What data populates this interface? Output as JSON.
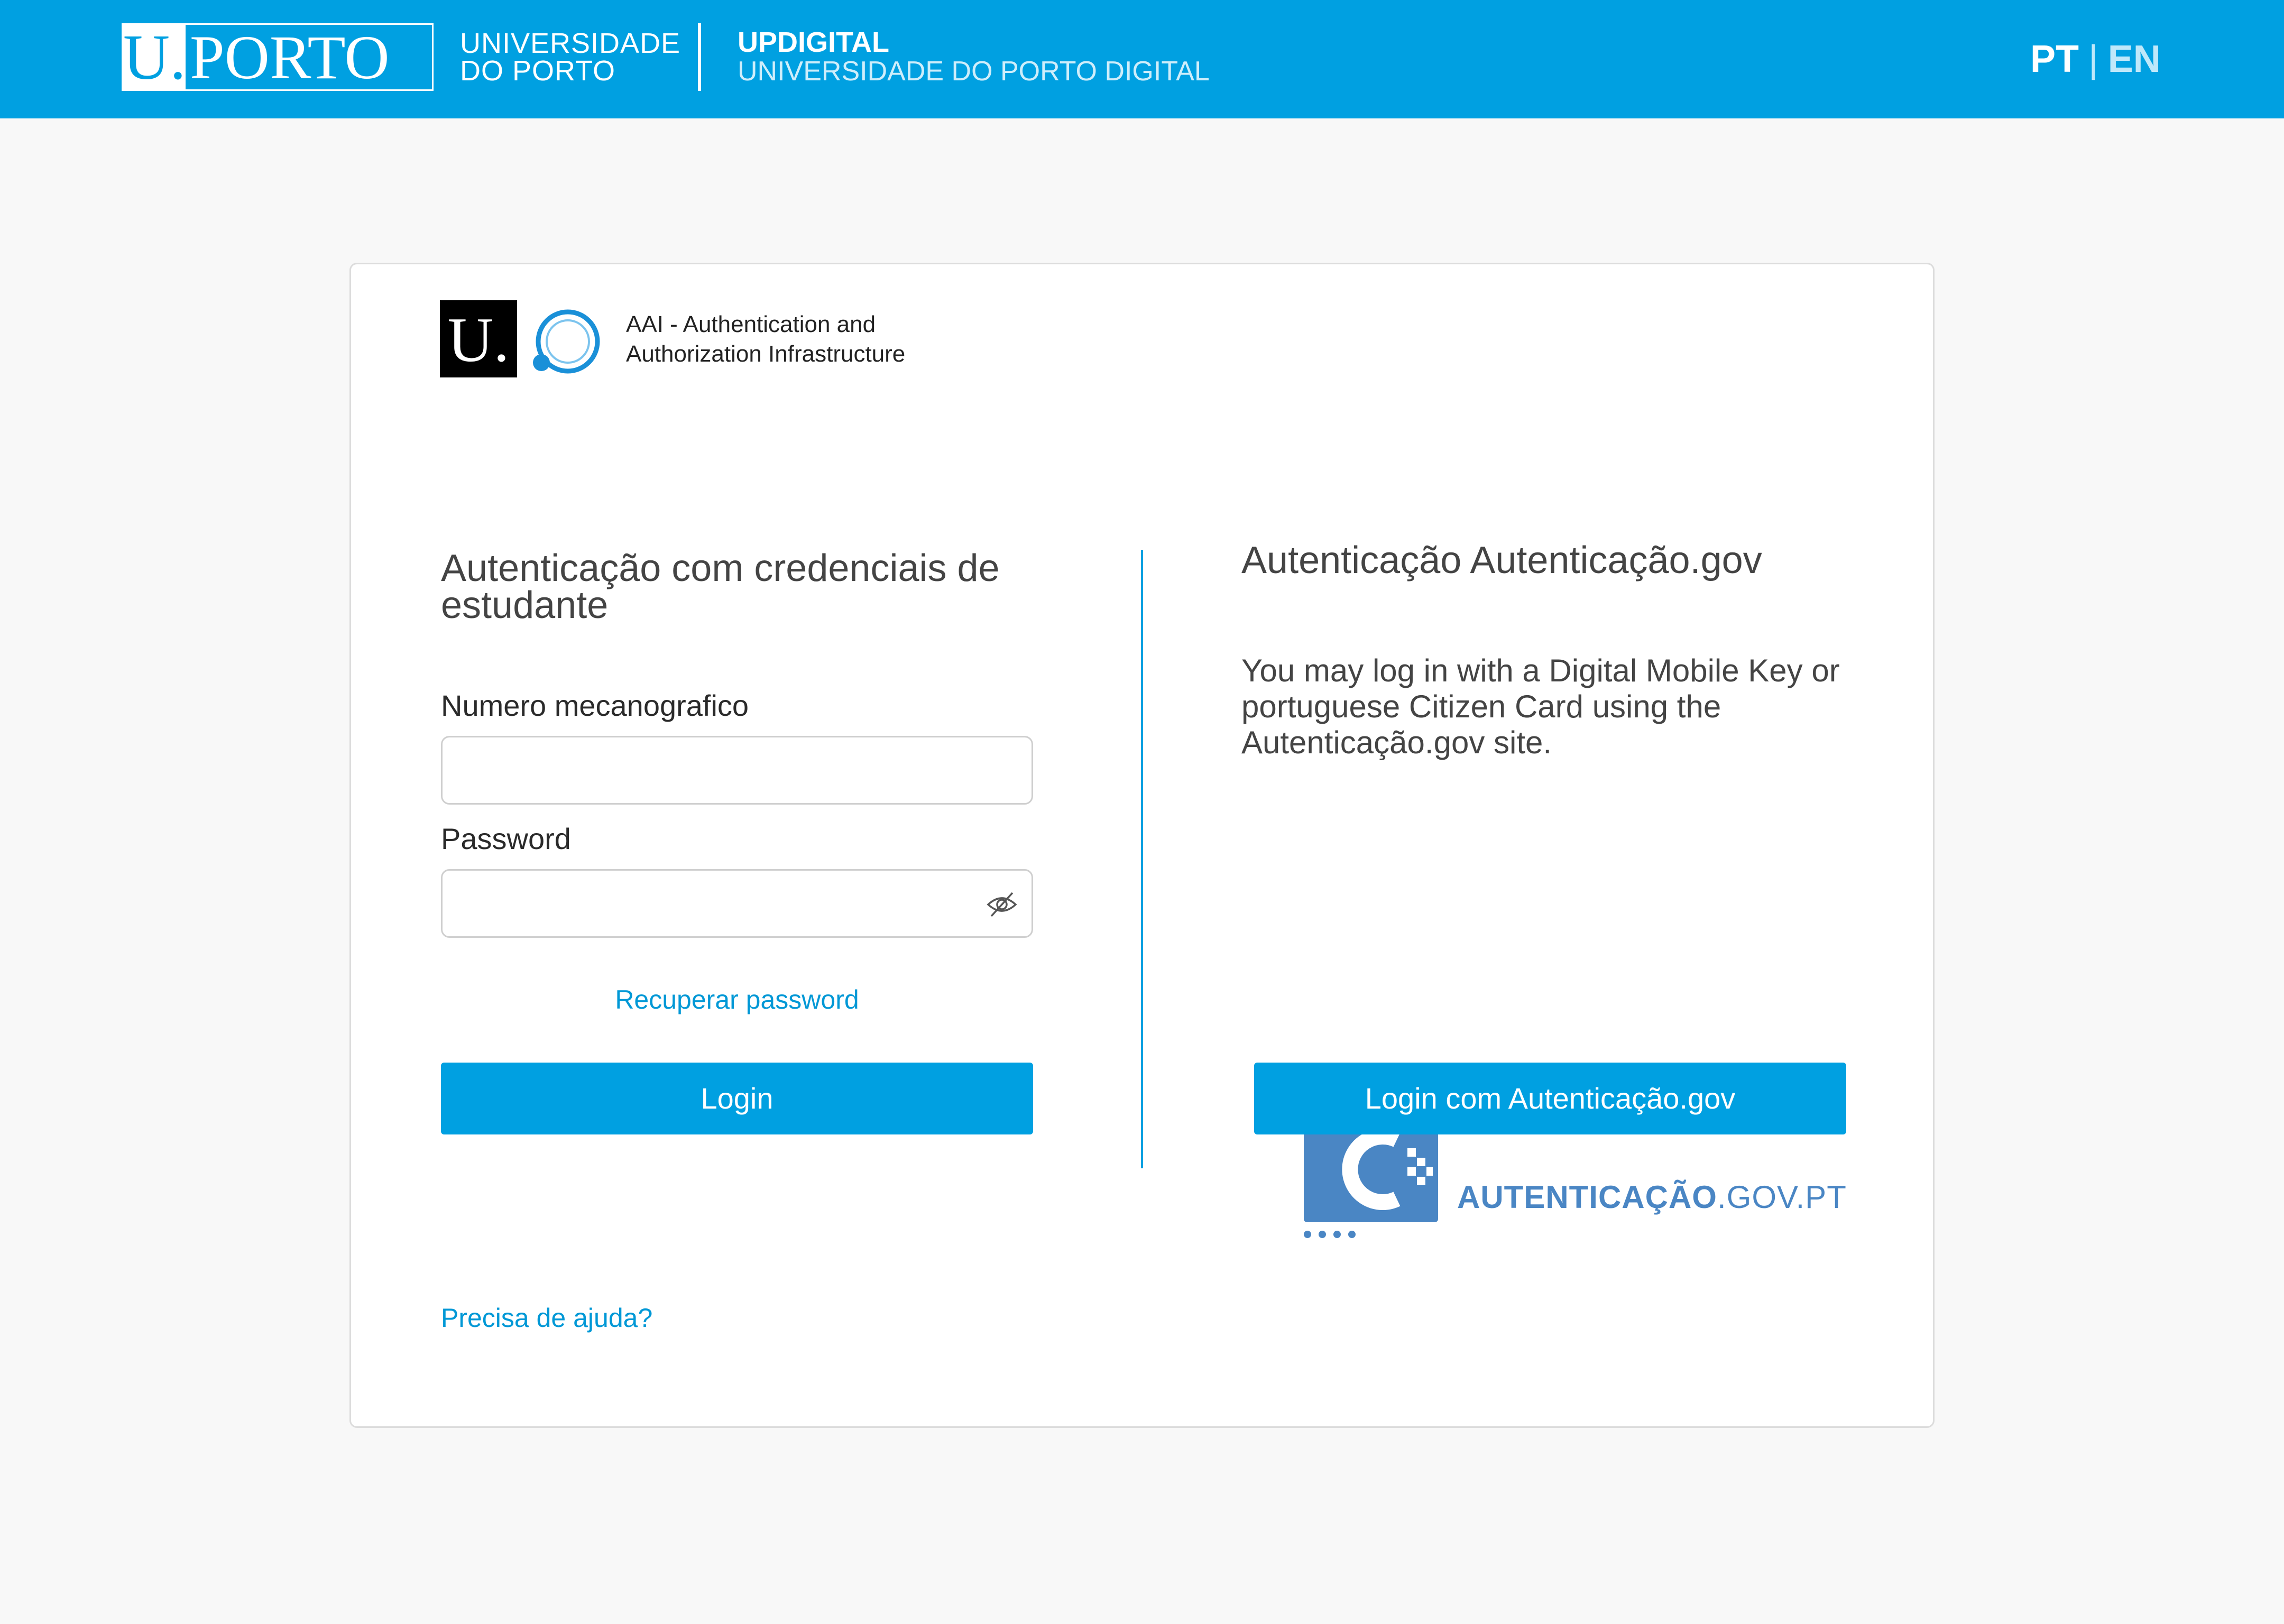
{
  "header": {
    "logo_u": "U.",
    "logo_porto": "PORTO",
    "university_line1": "UNIVERSIDADE",
    "university_line2": "DO PORTO",
    "updigital_title": "UPDIGITAL",
    "updigital_subtitle": "UNIVERSIDADE DO PORTO DIGITAL",
    "lang_pt": "PT",
    "lang_separator": "|",
    "lang_en": "EN"
  },
  "aai_logo": {
    "u": "U.",
    "line1": "AAI - Authentication and",
    "line2": "Authorization Infrastructure"
  },
  "student_login": {
    "title": "Autenticação com credenciais de estudante",
    "number_label": "Numero mecanografico",
    "number_value": "",
    "password_label": "Password",
    "password_value": "",
    "recover_link": "Recuperar password",
    "login_button": "Login"
  },
  "gov_login": {
    "title": "Autenticação Autenticação.gov",
    "description": "You may log in with a Digital Mobile Key or portuguese Citizen Card  using the Autenticação.gov site.",
    "logo_text_bold": "AUTENTICAÇÃO",
    "logo_text_rest": ".GOV.PT",
    "login_button": "Login com Autenticação.gov"
  },
  "help_link": "Precisa de ajuda?",
  "colors": {
    "brand_blue": "#00a0e1",
    "gov_blue": "#4a86c4",
    "link_blue": "#0098d6"
  },
  "icons": {
    "password_toggle": "eye-slash-icon",
    "aai_logo": "aai-circle-icon",
    "gov_logo": "autenticacao-gov-icon"
  }
}
